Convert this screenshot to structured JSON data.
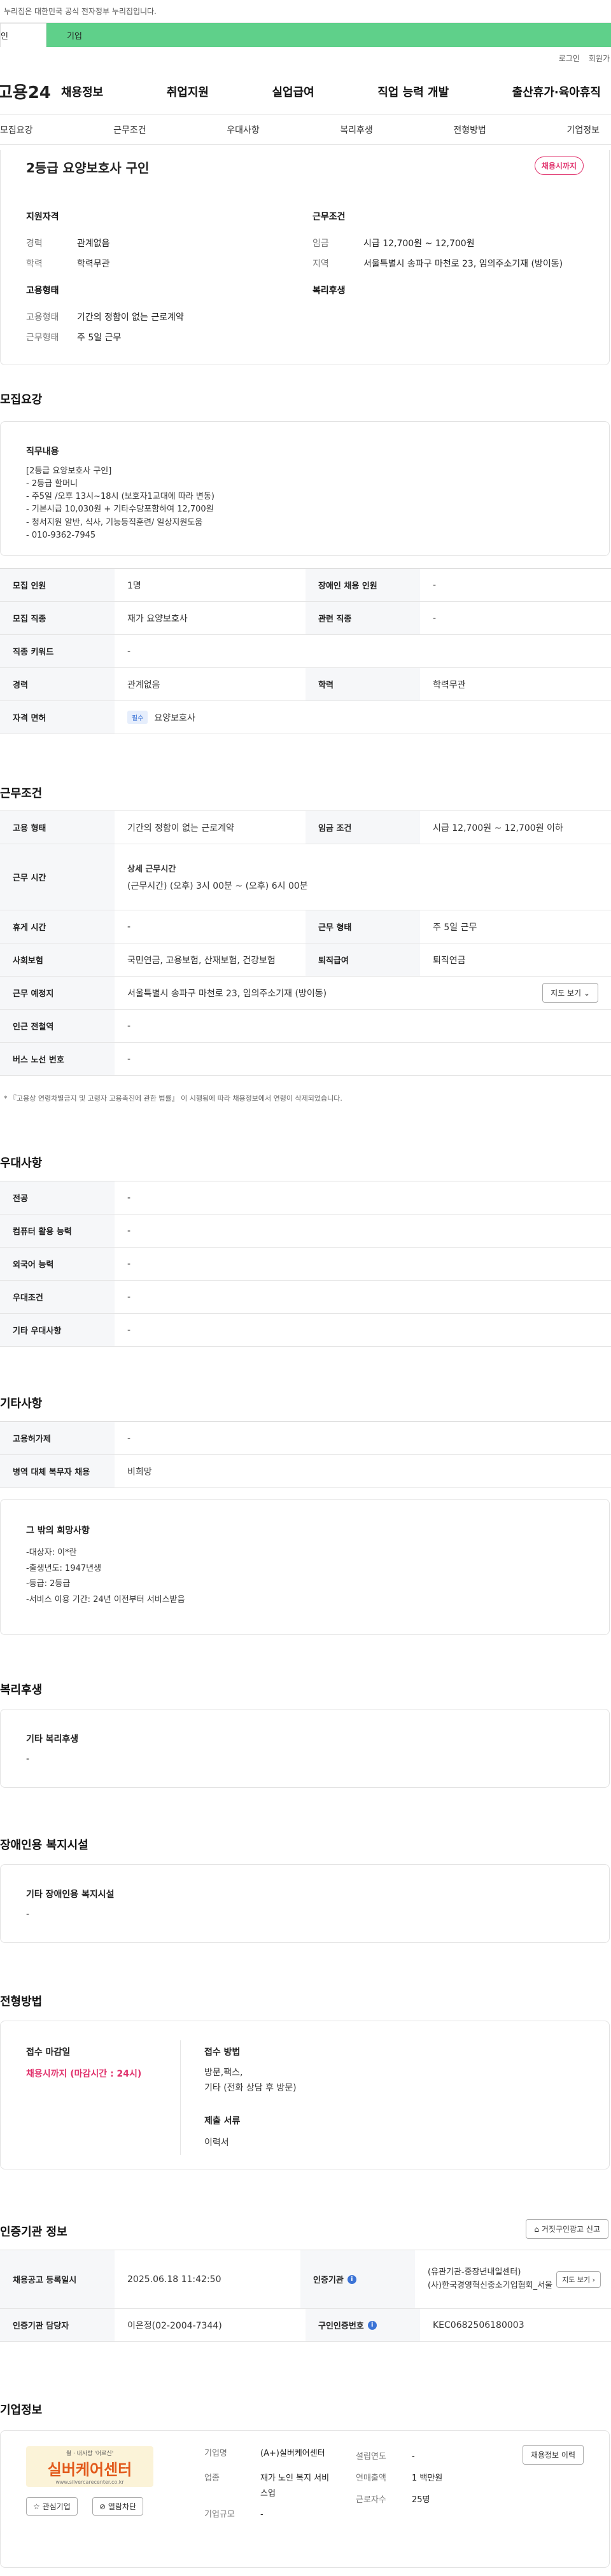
{
  "gov_bar": "누리집은 대한민국 공식 전자정부 누리집입니다.",
  "site_tabs": [
    "인",
    "기업"
  ],
  "util": [
    "로그인",
    "회원가"
  ],
  "logo": "고용24",
  "gnb": [
    "채용정보",
    "취업지원",
    "실업급여",
    "직업 능력 개발",
    "출산휴가·육아휴직"
  ],
  "subnav": [
    "모집요강",
    "근무조건",
    "우대사항",
    "복리후생",
    "전형방법",
    "기업정보"
  ],
  "summary": {
    "title": "2등급 요양보호사 구인",
    "badge": "채용시까지",
    "qual_title": "지원자격",
    "career_k": "경력",
    "career_v": "관계없음",
    "edu_k": "학력",
    "edu_v": "학력무관",
    "cond_title": "근무조건",
    "wage_k": "임금",
    "wage_v": "시급 12,700원 ~ 12,700원",
    "area_k": "지역",
    "area_v": "서울특별시 송파구 마천로 23, 임의주소기재 (방이동)",
    "emp_title": "고용형태",
    "emptype_k": "고용형태",
    "emptype_v": "기간의 정함이 없는 근로계약",
    "work_k": "근무형태",
    "work_v": "주 5일 근무",
    "welfare_title": "복리후생"
  },
  "recruit": {
    "title": "모집요강",
    "duty_title": "직무내용",
    "duty_text": "[2등급 요양보호사 구인]\n- 2등급 할머니\n- 주5일 /오후 13시~18시 (보호자1교대에 따라 변동)\n- 기본시급 10,030원 + 기타수당포함하여 12,700원\n- 청서지원 알반, 식사, 기능등직훈련/ 일상지원도움\n- 010-9362-7945",
    "rows": [
      [
        "모집 인원",
        "1명",
        "장애인 채용 인원",
        "-"
      ],
      [
        "모집 직종",
        "재가 요양보호사",
        "관련 직종",
        "-"
      ],
      [
        "직종 키워드",
        "-"
      ],
      [
        "경력",
        "관계없음",
        "학력",
        "학력무관"
      ],
      [
        "자격 면허",
        "요양보호사"
      ]
    ],
    "license_tag": "필수"
  },
  "conditions": {
    "title": "근무조건",
    "emp_k": "고용 형태",
    "emp_v": "기간의 정함이 없는 근로계약",
    "wage_k": "임금 조건",
    "wage_v": "시급 12,700원 ~ 12,700원 이하",
    "time_k": "근무 시간",
    "time_sub": "상세 근무시간",
    "time_v": "(근무시간) (오후) 3시 00분 ~ (오후) 6시 00분",
    "rest_k": "휴게 시간",
    "rest_v": "-",
    "form_k": "근무 형태",
    "form_v": "주 5일 근무",
    "ins_k": "사회보험",
    "ins_v": "국민연금, 고용보험, 산재보험, 건강보험",
    "ret_k": "퇴직급여",
    "ret_v": "퇴직연금",
    "place_k": "근무 예정지",
    "place_v": "서울특별시 송파구 마천로 23, 임의주소기재 (방이동)",
    "map_btn": "지도 보기",
    "sub_k": "인근 전철역",
    "sub_v": "-",
    "bus_k": "버스 노선 번호",
    "bus_v": "-",
    "note": "* 『고용상 연령차별금지 및 고령자 고용촉진에 관한 법률』 이 시행됨에 따라 채용정보에서 연령이 삭제되었습니다."
  },
  "pref": {
    "title": "우대사항",
    "rows": [
      [
        "전공",
        "-"
      ],
      [
        "컴퓨터 활용 능력",
        "-"
      ],
      [
        "외국어 능력",
        "-"
      ],
      [
        "우대조건",
        "-"
      ],
      [
        "기타 우대사항",
        "-"
      ]
    ]
  },
  "etc": {
    "title": "기타사항",
    "rows": [
      [
        "고용허가제",
        "-"
      ],
      [
        "병역 대체 복무자 채용",
        "비희망"
      ]
    ],
    "wish_title": "그 밖의 희망사항",
    "wish_text": "-대상자: 이*란\n-출생년도: 1947년생\n-등급: 2등급\n-서비스 이용 기간: 24년 이전부터 서비스받음"
  },
  "welfare": {
    "title": "복리후생",
    "sub": "기타 복리후생",
    "val": "-"
  },
  "disab": {
    "title": "장애인용 복지시설",
    "sub": "기타 장애인용 복지시설",
    "val": "-"
  },
  "selection": {
    "title": "전형방법",
    "deadline_k": "접수 마감일",
    "deadline_v": "채용시까지 (마감시간 : 24시)",
    "method_k": "접수 방법",
    "method_v": "방문,팩스,\n기타 (전화 상담 후 방문)",
    "docs_k": "제출 서류",
    "docs_v": "이력서"
  },
  "cert": {
    "title": "인증기관 정보",
    "report_btn": "거짓구인광고 신고",
    "reg_k": "채용공고 등록일시",
    "reg_v": "2025.06.18 11:42:50",
    "org_k": "인증기관",
    "org_v": "(유관기관-중장년내일센터)\n(사)한국경영혁신중소기업협회_서울",
    "org_btn": "지도 보기",
    "mgr_k": "인증기관 담당자",
    "mgr_v": "이은정(02-2004-7344)",
    "num_k": "구인인증번호",
    "num_v": "KEC0682506180003"
  },
  "company": {
    "title": "기업정보",
    "logo_text": "실버케어센터",
    "logo_top": "월 · 내사랑 '어르신'",
    "logo_url": "www.silvercarecenter.co.kr",
    "fav_btn": "관심기업",
    "block_btn": "열람차단",
    "info_btn": "채용정보 이력",
    "name_k": "기업명",
    "name_v": "(A+)실버케어센터",
    "est_k": "설립연도",
    "est_v": "-",
    "biz_k": "업종",
    "biz_v": "재가 노인 복지 서비스업",
    "sales_k": "연매출액",
    "sales_v": "1 백만원",
    "emp_k": "근로자수",
    "emp_v": "25명",
    "size_k": "기업규모",
    "size_v": "-"
  },
  "colors": {
    "green": "#5fd08a",
    "red": "#e0306b",
    "blue": "#3b73d6"
  }
}
